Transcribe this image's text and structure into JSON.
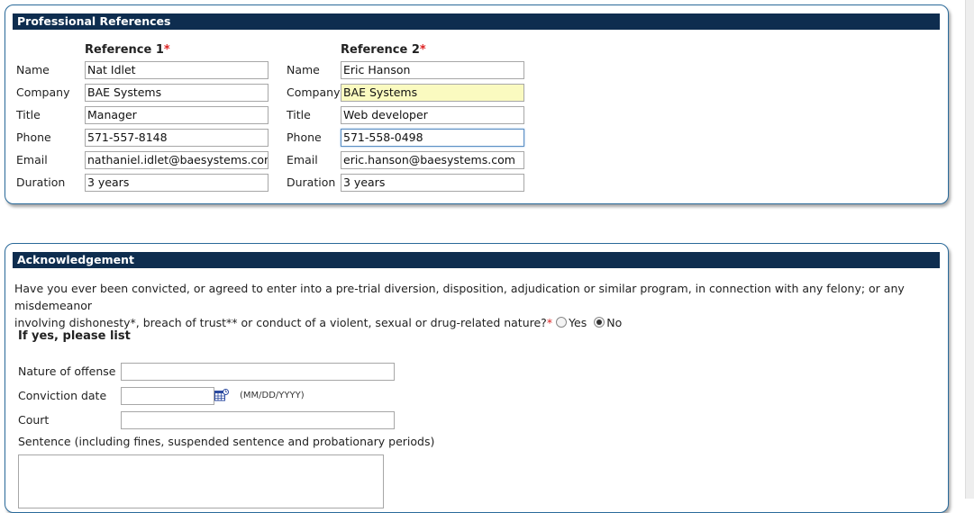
{
  "references": {
    "section_title": "Professional References",
    "ref1": {
      "title": "Reference 1",
      "required": "*",
      "labels": {
        "name": "Name",
        "company": "Company",
        "title": "Title",
        "phone": "Phone",
        "email": "Email",
        "duration": "Duration"
      },
      "values": {
        "name": "Nat Idlet",
        "company": "BAE Systems",
        "title": "Manager",
        "phone": "571-557-8148",
        "email": "nathaniel.idlet@baesystems.com",
        "duration": "3 years"
      }
    },
    "ref2": {
      "title": "Reference 2",
      "required": "*",
      "labels": {
        "name": "Name",
        "company": "Company",
        "title": "Title",
        "phone": "Phone",
        "email": "Email",
        "duration": "Duration"
      },
      "values": {
        "name": "Eric Hanson",
        "company": "BAE Systems",
        "title": "Web developer",
        "phone": "571-558-0498",
        "email": "eric.hanson@baesystems.com",
        "duration": "3 years"
      }
    }
  },
  "acknowledgement": {
    "section_title": "Acknowledgement",
    "question_line1": "Have you ever been convicted, or agreed to enter into a pre-trial diversion, disposition, adjudication or similar program, in connection with any felony; or any misdemeanor",
    "question_line2": "involving dishonesty*, breach of trust** or conduct of a violent, sexual or drug-related nature?",
    "required": "*",
    "yes_label": "Yes",
    "no_label": "No",
    "selected": "No",
    "if_yes": "If yes, please list",
    "nature_label": "Nature of offense",
    "nature_value": "",
    "conviction_label": "Conviction date",
    "conviction_value": "",
    "date_hint": "(MM/DD/YYYY)",
    "court_label": "Court",
    "court_value": "",
    "sentence_label": "Sentence (including fines, suspended sentence and probationary periods)",
    "icons": {
      "calendar": "calendar-icon"
    }
  }
}
